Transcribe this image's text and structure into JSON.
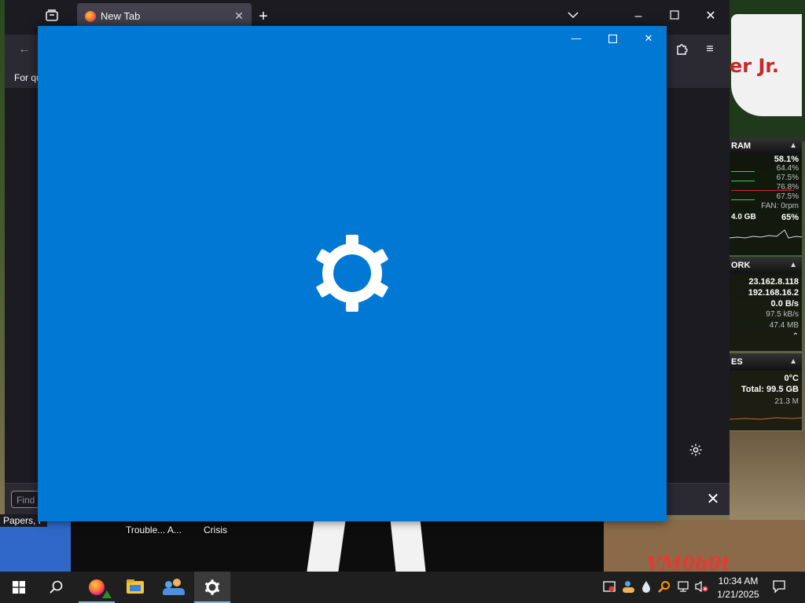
{
  "desktop": {
    "labels": [
      "Trouble... A...",
      "Crisis"
    ],
    "wallpaper_text_top": "er Jr.",
    "wallpaper_text_bottom": "VM0b0t"
  },
  "browser": {
    "tab_title": "New Tab",
    "bookmark_text": "For qu",
    "find_placeholder": "Find",
    "status_text": "Papers, F",
    "icons": [
      "tab-manager-icon",
      "firefox-icon",
      "close-icon",
      "new-tab-icon",
      "tab-list-icon",
      "minimize-icon",
      "maximize-icon",
      "close-icon",
      "back-icon",
      "extensions-icon",
      "menu-icon",
      "gear-icon",
      "close-icon"
    ]
  },
  "monitor": {
    "cpu": {
      "header": "RAM",
      "total": "58.1%",
      "cores": [
        "64.4%",
        "67.5%",
        "76.8%",
        "67.5%"
      ],
      "fan": "FAN: 0rpm",
      "ram_used": "4.0 GB",
      "ram_percent": "65%"
    },
    "network": {
      "header": "ORK",
      "ip_public": "23.162.8.118",
      "ip_local": "192.168.16.2",
      "speed": "0.0 B/s",
      "up": "97.5 kB/s",
      "down": "47.4 MB"
    },
    "drives": {
      "header": "ES",
      "temp": "0°C",
      "total": "Total: 99.5 GB",
      "used": "21.3 M"
    }
  },
  "settings_window": {
    "accent_color": "#0078d4",
    "icon": "gear-icon",
    "controls": [
      "minimize-icon",
      "maximize-icon",
      "close-icon"
    ]
  },
  "taskbar": {
    "apps": [
      "start-icon",
      "search-icon",
      "firefox-icon",
      "file-explorer-icon",
      "people-icon",
      "settings-icon"
    ],
    "time": "10:34 AM",
    "date": "1/21/2025"
  }
}
